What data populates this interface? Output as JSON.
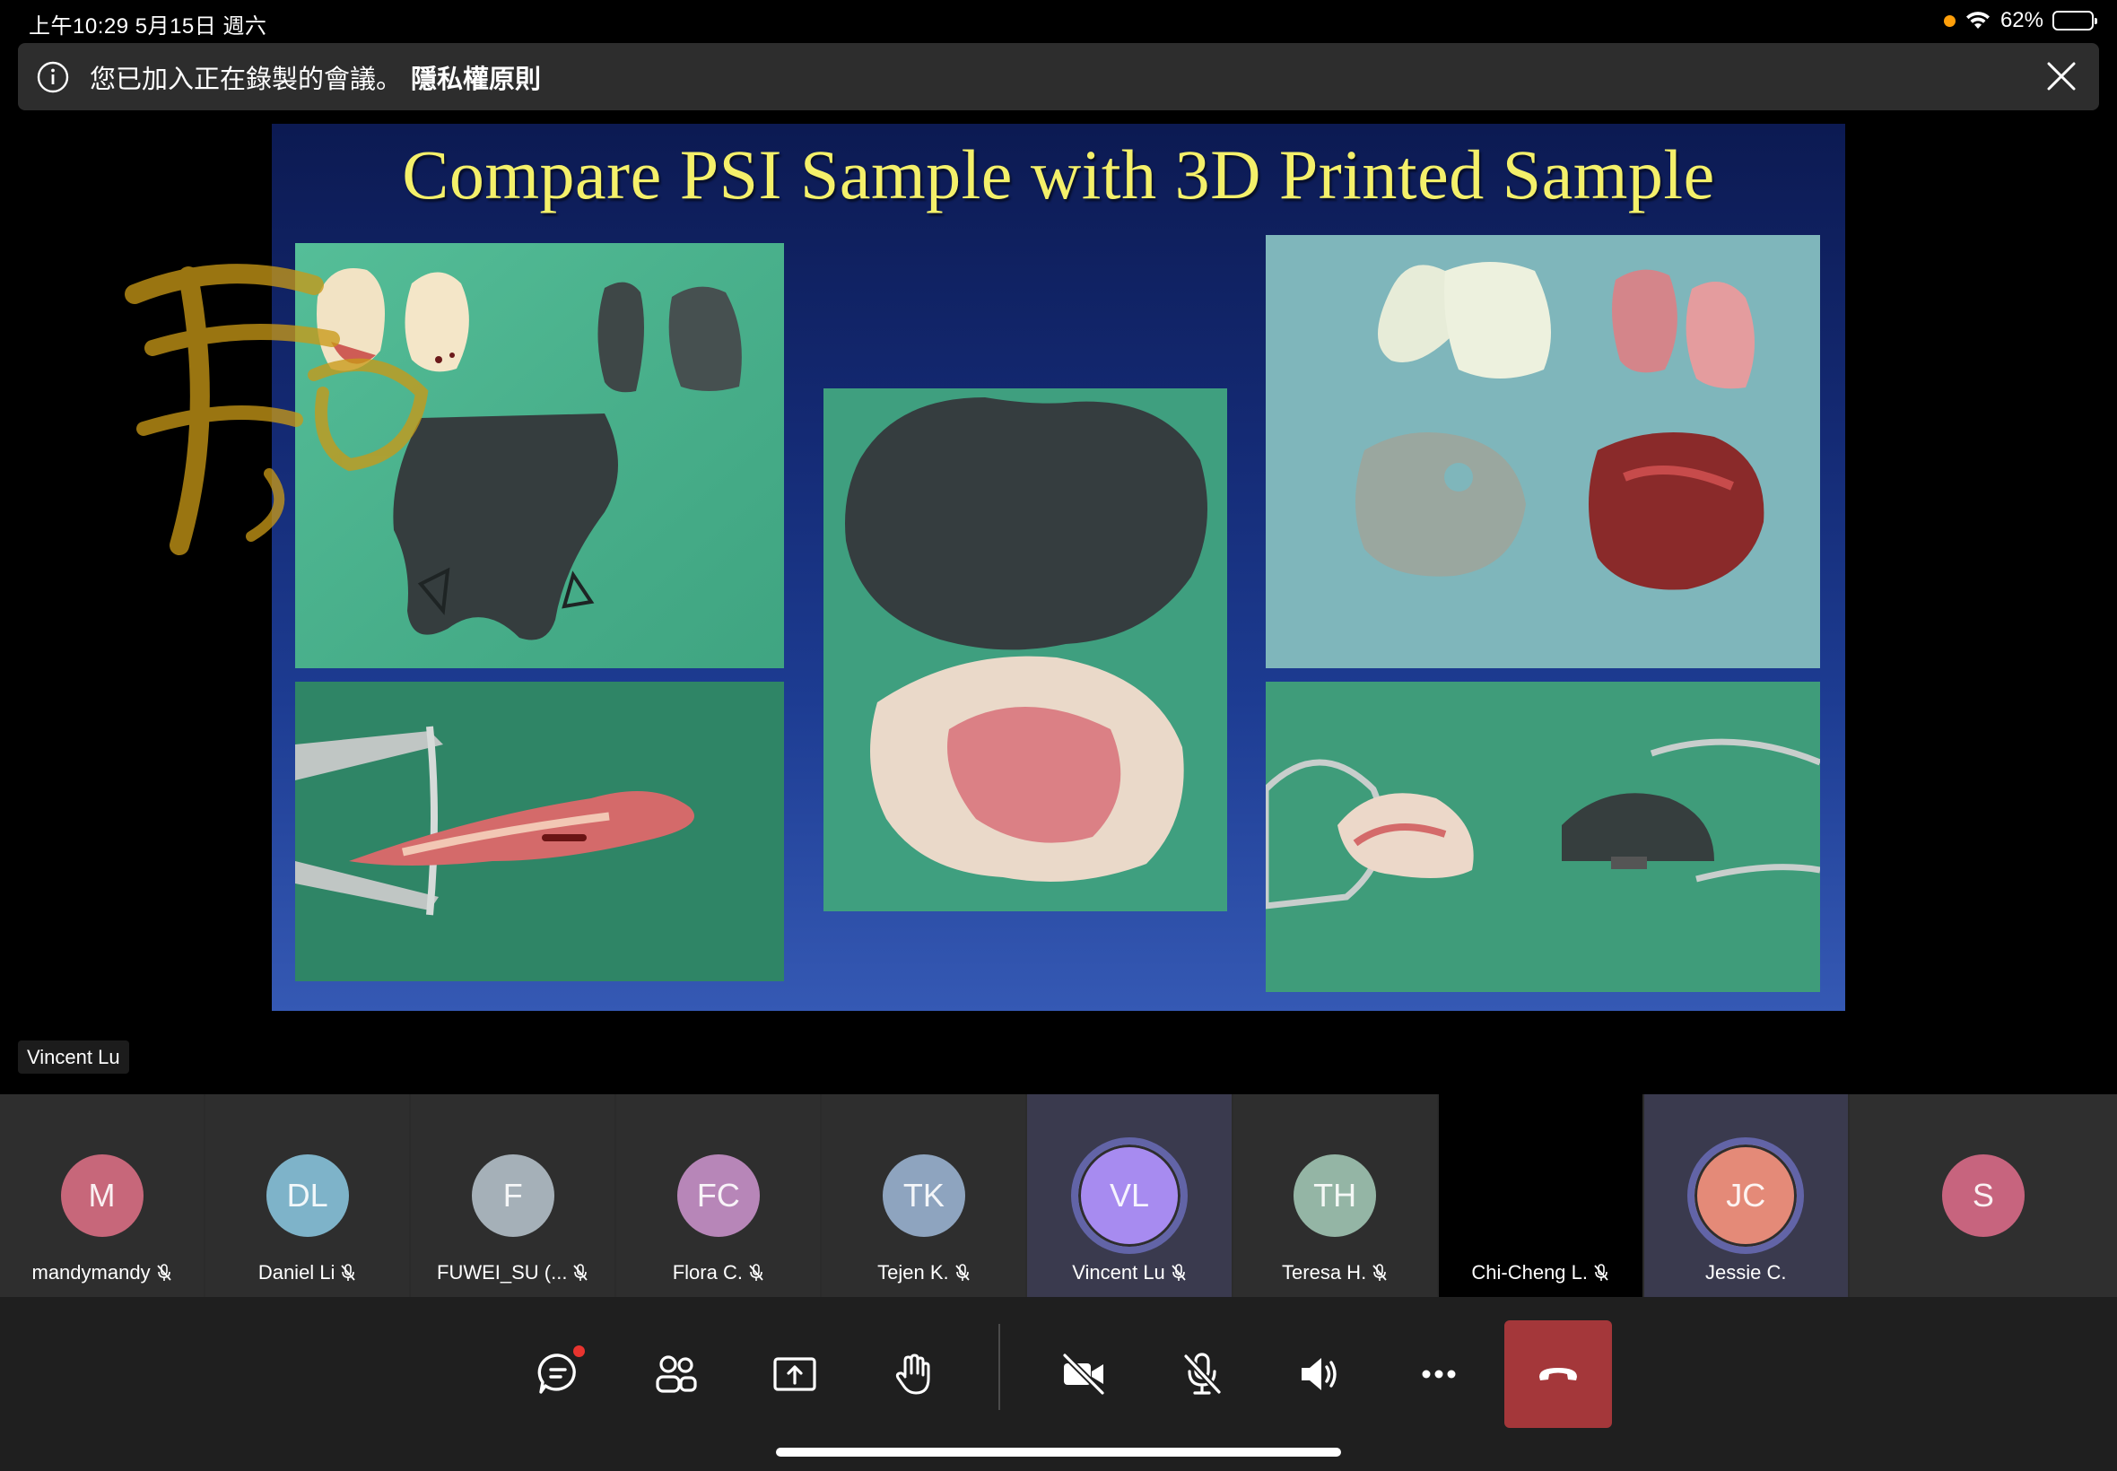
{
  "status_bar": {
    "time": "上午10:29   5月15日 週六",
    "battery": "62%",
    "battery_level": 0.62
  },
  "banner": {
    "message": "您已加入正在錄製的會議。",
    "link": "隱私權原則",
    "icons": {
      "info": "info-icon",
      "close": "close-icon"
    }
  },
  "slide": {
    "title": "Compare PSI Sample with 3D Printed Sample"
  },
  "presenter": {
    "name": "Vincent Lu"
  },
  "participants": [
    {
      "initials": "M",
      "name": "mandymandy",
      "color": "#c7677a",
      "muted": true
    },
    {
      "initials": "DL",
      "name": "Daniel Li",
      "color": "#7eb3c9",
      "muted": true
    },
    {
      "initials": "F",
      "name": "FUWEI_SU (...",
      "color": "#a5b0b8",
      "muted": true
    },
    {
      "initials": "FC",
      "name": "Flora C.",
      "color": "#b786b8",
      "muted": true
    },
    {
      "initials": "TK",
      "name": "Tejen K.",
      "color": "#8ea4bf",
      "muted": true
    },
    {
      "initials": "VL",
      "name": "Vincent Lu",
      "color": "#a78bf0",
      "muted": true,
      "speaking": true
    },
    {
      "initials": "TH",
      "name": "Teresa H.",
      "color": "#94b5a5",
      "muted": true
    },
    {
      "initials": "",
      "name": "Chi-Cheng L.",
      "color": "#000000",
      "muted": true,
      "video_off": true
    },
    {
      "initials": "JC",
      "name": "Jessie C.",
      "color": "#e48a78",
      "muted": false,
      "speaking": true
    },
    {
      "initials": "S",
      "name": "",
      "color": "#c7647e",
      "muted": false
    }
  ],
  "controls": {
    "chat": "chat-icon",
    "participants": "people-icon",
    "share": "share-screen-icon",
    "raise_hand": "raise-hand-icon",
    "camera": "camera-off-icon",
    "mic": "mic-off-icon",
    "speaker": "speaker-icon",
    "more": "more-icon",
    "hangup": "hang-up-icon",
    "hangup_color": "#a4373a"
  }
}
